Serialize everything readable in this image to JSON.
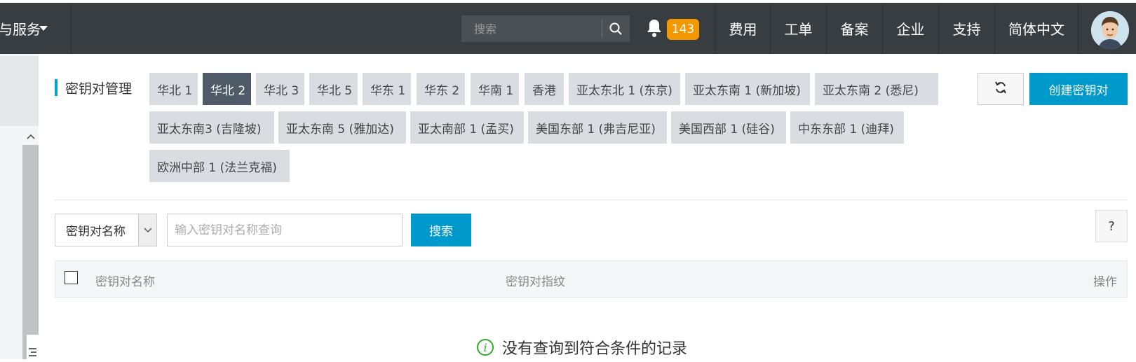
{
  "topbar": {
    "product_menu_label": "与服务",
    "search_placeholder": "搜索",
    "notification_count": "143",
    "nav": [
      "费用",
      "工单",
      "备案",
      "企业",
      "支持",
      "简体中文"
    ]
  },
  "page": {
    "title": "密钥对管理",
    "regions": [
      {
        "label": "华北 1",
        "active": false
      },
      {
        "label": "华北 2",
        "active": true
      },
      {
        "label": "华北 3",
        "active": false
      },
      {
        "label": "华北 5",
        "active": false
      },
      {
        "label": "华东 1",
        "active": false
      },
      {
        "label": "华东 2",
        "active": false
      },
      {
        "label": "华南 1",
        "active": false
      },
      {
        "label": "香港",
        "active": false
      },
      {
        "label": "亚太东北 1 (东京)",
        "active": false
      },
      {
        "label": "亚太东南 1 (新加坡)",
        "active": false
      },
      {
        "label": "亚太东南 2 (悉尼)",
        "active": false
      },
      {
        "label": "亚太东南3 (吉隆坡)",
        "active": false
      },
      {
        "label": "亚太东南 5 (雅加达)",
        "active": false
      },
      {
        "label": "亚太南部 1 (孟买)",
        "active": false
      },
      {
        "label": "美国东部 1 (弗吉尼亚)",
        "active": false
      },
      {
        "label": "美国西部 1 (硅谷)",
        "active": false
      },
      {
        "label": "中东东部 1 (迪拜)",
        "active": false
      },
      {
        "label": "欧洲中部 1 (法兰克福)",
        "active": false
      }
    ],
    "create_button": "创建密钥对"
  },
  "filter": {
    "select_value": "密钥对名称",
    "input_placeholder": "输入密钥对名称查询",
    "search_button": "搜索",
    "help_label": "?"
  },
  "table": {
    "columns": [
      "密钥对名称",
      "密钥对指纹",
      "操作"
    ]
  },
  "empty_state": {
    "message": "没有查询到符合条件的记录"
  },
  "colors": {
    "topbar_bg": "#373d41",
    "accent": "#0099cc",
    "badge": "#f39800",
    "active_region": "#4f5a69",
    "success_icon": "#2eaa2e"
  }
}
